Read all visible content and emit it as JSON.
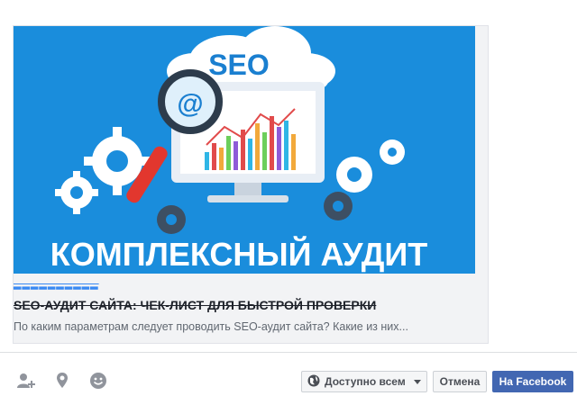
{
  "link_preview": {
    "image_badge": "SEO",
    "image_caption": "КОМПЛЕКСНЫЙ АУДИТ",
    "title": "SEO-АУДИТ САЙТА: ЧЕК-ЛИСТ ДЛЯ БЫСТРОЙ ПРОВЕРКИ",
    "description": "По каким параметрам следует проводить SEO-аудит сайта? Какие из них...",
    "chart_icon": "@"
  },
  "footer": {
    "icons": [
      "tag-friends-icon",
      "location-pin-icon",
      "feeling-smiley-icon"
    ],
    "privacy_label": "Доступно всем",
    "cancel_label": "Отмена",
    "share_label": "На Facebook"
  },
  "colors": {
    "hero_background": "#1a8ddc",
    "share_button": "#4267b2",
    "title_text": "#1d2129",
    "description_text": "#606770"
  }
}
